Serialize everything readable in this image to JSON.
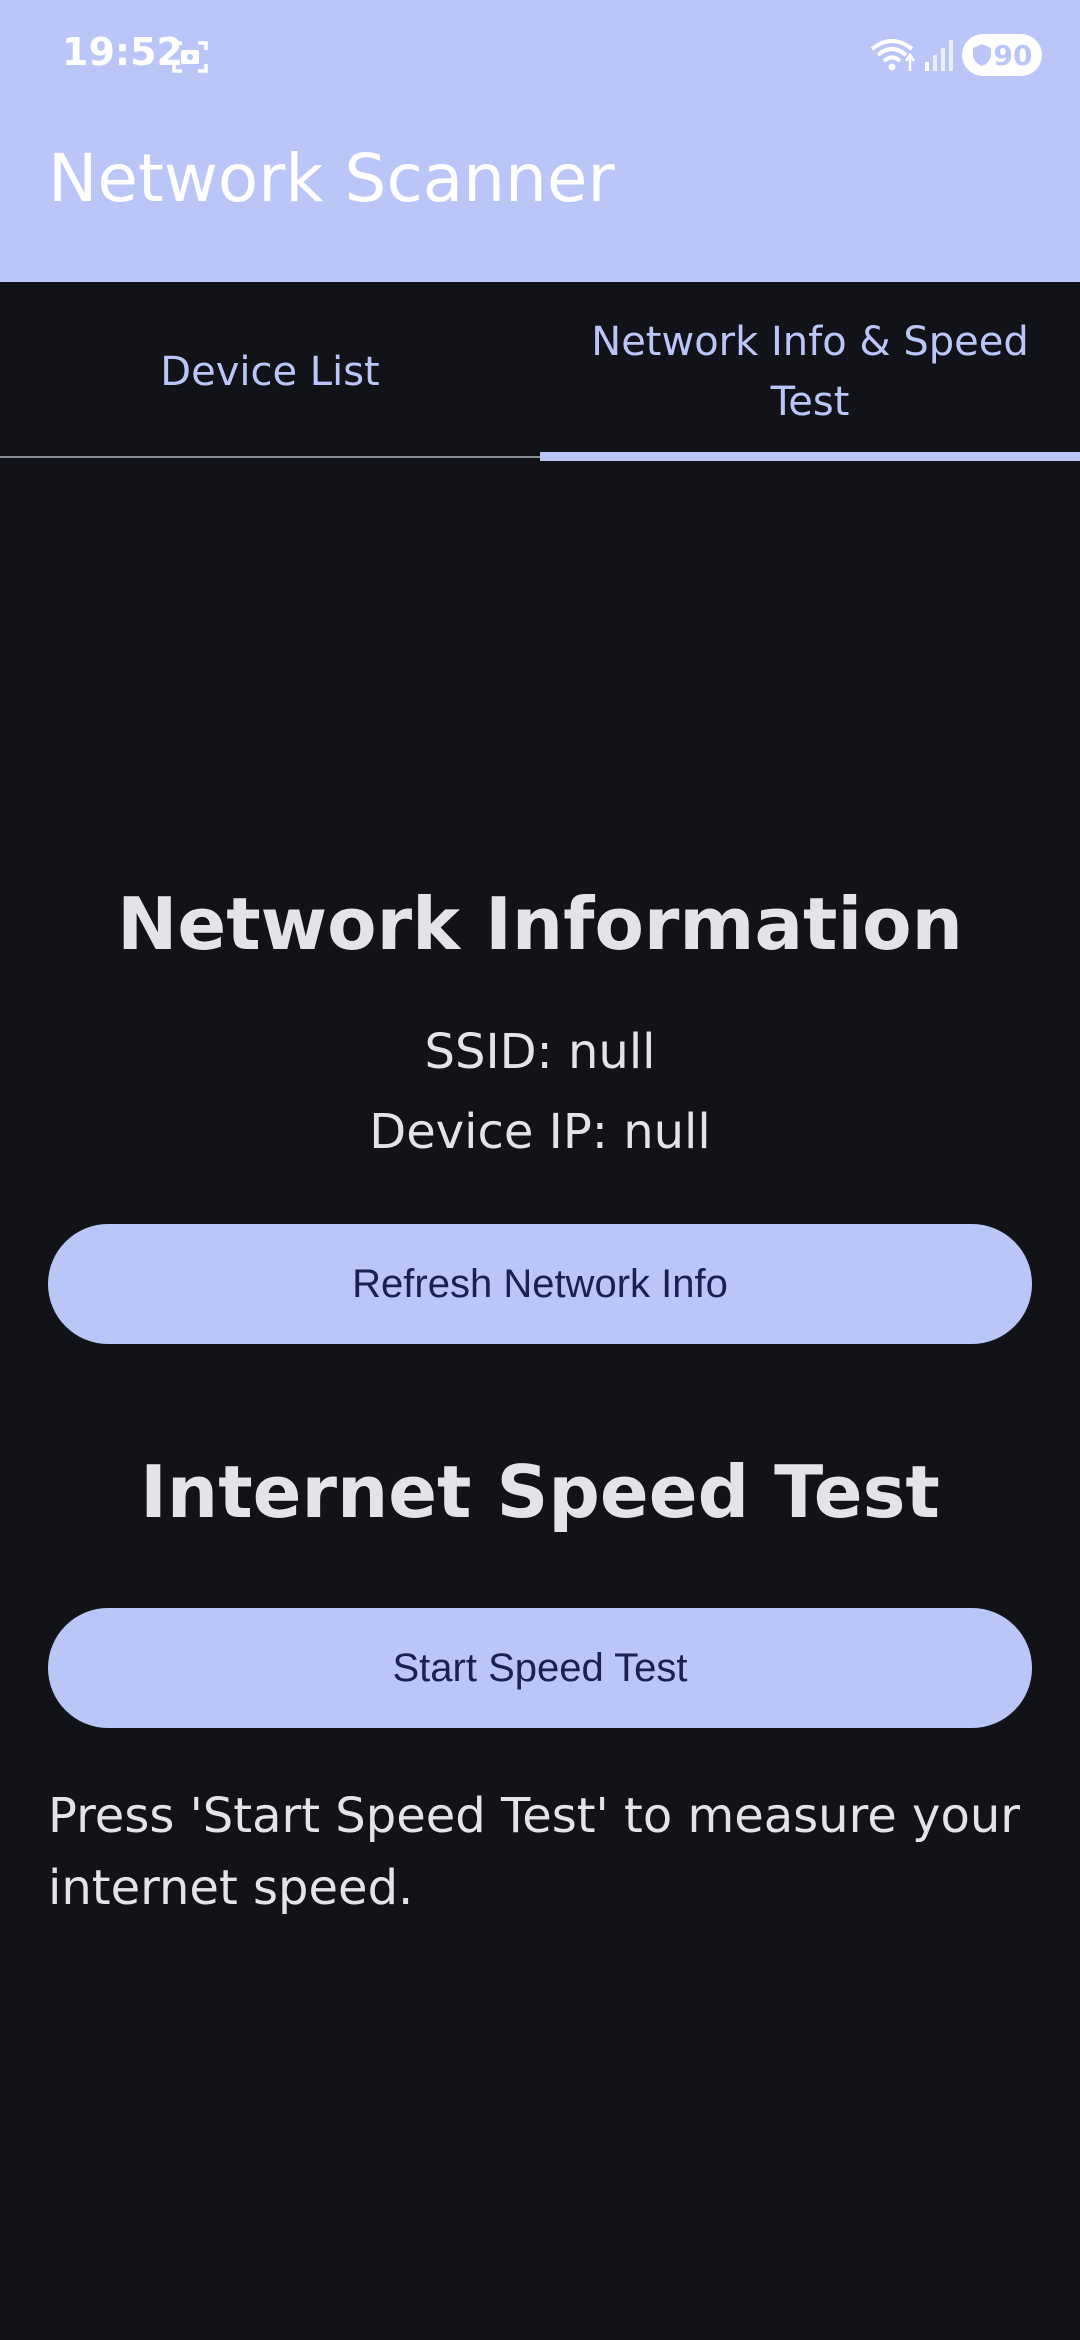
{
  "status_bar": {
    "time": "19:52",
    "battery": "90"
  },
  "app": {
    "title": "Network Scanner"
  },
  "tabs": [
    {
      "label": "Device List",
      "selected": false
    },
    {
      "label": "Network Info & Speed Test",
      "selected": true
    }
  ],
  "network_info": {
    "heading": "Network Information",
    "ssid": "SSID: null",
    "device_ip": "Device IP: null",
    "refresh_label": "Refresh Network Info"
  },
  "speed_test": {
    "heading": "Internet Speed Test",
    "start_label": "Start Speed Test",
    "hint": "Press 'Start Speed Test' to measure your internet speed."
  },
  "colors": {
    "accent": "#BBC6F8",
    "background": "#121318",
    "on_accent": "#1A2150",
    "text": "#E3E3EA"
  }
}
